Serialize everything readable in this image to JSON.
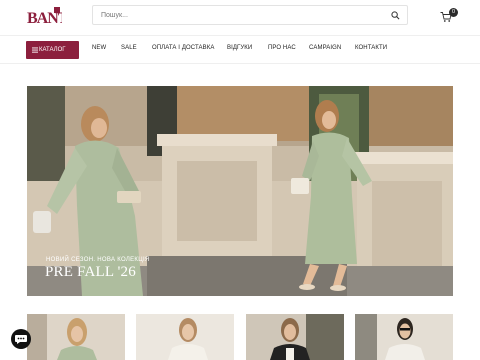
{
  "brand": {
    "logo_text": "BANT"
  },
  "search": {
    "placeholder": "Пошук..."
  },
  "cart": {
    "count": "0"
  },
  "nav": {
    "catalog_label": "КАТАЛОГ",
    "items": [
      "NEW",
      "SALE",
      "ОПЛАТА І ДОСТАВКА",
      "ВІДГУКИ",
      "ПРО НАС",
      "CAMPAIGN",
      "КОНТАКТИ"
    ]
  },
  "hero": {
    "subtitle": "НОВИЙ СЕЗОН. НОВА КОЛЕКЦІЯ",
    "title": "PRE FALL '26"
  },
  "colors": {
    "accent": "#8c1f3d",
    "dress": "#a9b79a",
    "stone": "#d8cdbd"
  },
  "icons": [
    "search-icon",
    "cart-icon",
    "menu-icon",
    "chat-icon"
  ]
}
